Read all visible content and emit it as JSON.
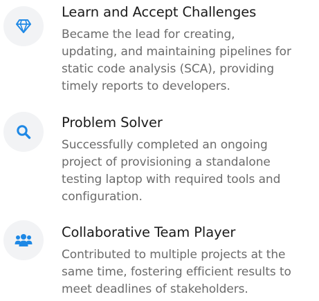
{
  "colors": {
    "accent": "#1e88e5",
    "icon_bg": "#f2f3f5",
    "title": "#1a1a1a",
    "description": "#6b6b6b"
  },
  "features": [
    {
      "icon": "diamond-icon",
      "title": "Learn and Accept Challenges",
      "description_lines": [
        "Became the lead for creating,",
        "updating, and maintaining pipelines for",
        "static code analysis (SCA), providing",
        "timely reports to developers."
      ]
    },
    {
      "icon": "search-icon",
      "title": "Problem Solver",
      "description_lines": [
        "Successfully completed an ongoing",
        "project of provisioning a standalone",
        "testing laptop with required tools and",
        "configuration."
      ]
    },
    {
      "icon": "users-icon",
      "title": "Collaborative Team Player",
      "description_lines": [
        "Contributed to multiple projects at the",
        "same time, fostering efficient results to",
        "meet deadlines of stakeholders."
      ]
    }
  ]
}
